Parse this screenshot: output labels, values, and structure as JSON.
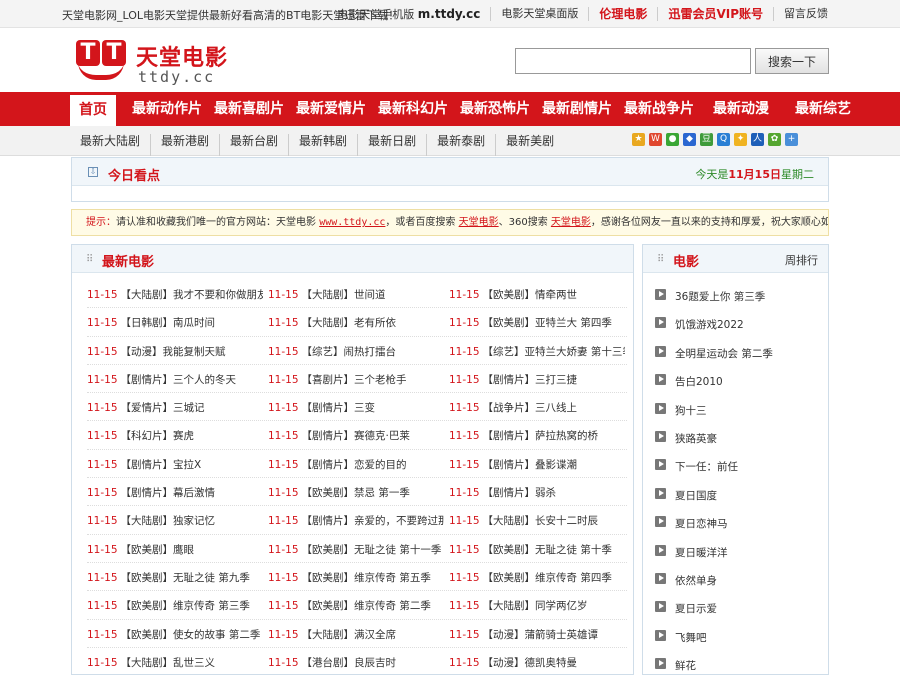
{
  "topbar": {
    "slogan": "天堂电影网_LOL电影天堂提供最新好看高清的BT电影天堂迅雷下载！",
    "mobile_label": "电影天堂手机版",
    "mobile_url": "m.ttdy.cc",
    "desktop_label": "电影天堂桌面版",
    "ethics_label": "伦理电影",
    "vip_label": "迅雷会员VIP账号",
    "feedback_label": "留言反馈"
  },
  "logo": {
    "cn": "天堂电影",
    "en": "ttdy.cc",
    "mark": "TT"
  },
  "search": {
    "value": "",
    "placeholder": "",
    "button": "搜索一下"
  },
  "nav": {
    "home": "首页",
    "items": [
      "最新动作片",
      "最新喜剧片",
      "最新爱情片",
      "最新科幻片",
      "最新恐怖片",
      "最新剧情片",
      "最新战争片",
      "最新动漫",
      "最新综艺"
    ]
  },
  "subnav": {
    "items": [
      "最新大陆剧",
      "最新港剧",
      "最新台剧",
      "最新韩剧",
      "最新日剧",
      "最新泰剧",
      "最新美剧"
    ],
    "share_icons": [
      "share-star-icon",
      "share-weibo-icon",
      "share-chat-icon",
      "share-baidu-icon",
      "share-douban-icon",
      "share-qq-icon",
      "share-qzone-icon",
      "share-renren-icon",
      "share-clover-icon",
      "share-plus-icon"
    ]
  },
  "today": {
    "title": "今日看点",
    "date_prefix": "今天是",
    "date": "11月15日",
    "weekday": "星期二"
  },
  "notice": {
    "label": "提示：",
    "text1": "请认准和收藏我们唯一的官方网站：天堂电影",
    "site": "www.ttdy.cc",
    "text2": "，或者百度搜索",
    "kw1": "天堂电影",
    "text3": "、360搜索",
    "kw2": "天堂电影",
    "text4": "，感谢各位网友一直以来的支持和厚爱，祝大家顺心如意！"
  },
  "latest": {
    "title": "最新电影",
    "rows": [
      [
        [
          "11-15",
          "【大陆剧】我才不要和你做朋友"
        ],
        [
          "11-15",
          "【大陆剧】世间道"
        ],
        [
          "11-15",
          "【欧美剧】情牵两世"
        ]
      ],
      [
        [
          "11-15",
          "【日韩剧】南瓜时间"
        ],
        [
          "11-15",
          "【大陆剧】老有所依"
        ],
        [
          "11-15",
          "【欧美剧】亚特兰大 第四季"
        ]
      ],
      [
        [
          "11-15",
          "【动漫】我能复制天赋"
        ],
        [
          "11-15",
          "【综艺】闹热打擂台"
        ],
        [
          "11-15",
          "【综艺】亚特兰大娇妻 第十三季"
        ]
      ],
      [
        [
          "11-15",
          "【剧情片】三个人的冬天"
        ],
        [
          "11-15",
          "【喜剧片】三个老枪手"
        ],
        [
          "11-15",
          "【剧情片】三打三捷"
        ]
      ],
      [
        [
          "11-15",
          "【爱情片】三城记"
        ],
        [
          "11-15",
          "【剧情片】三变"
        ],
        [
          "11-15",
          "【战争片】三八线上"
        ]
      ],
      [
        [
          "11-15",
          "【科幻片】赛虎"
        ],
        [
          "11-15",
          "【剧情片】赛德克·巴莱"
        ],
        [
          "11-15",
          "【剧情片】萨拉热窝的桥"
        ]
      ],
      [
        [
          "11-15",
          "【剧情片】宝拉X"
        ],
        [
          "11-15",
          "【剧情片】恋爱的目的"
        ],
        [
          "11-15",
          "【剧情片】叠影谍潮"
        ]
      ],
      [
        [
          "11-15",
          "【剧情片】幕后激情"
        ],
        [
          "11-15",
          "【欧美剧】禁忌 第一季"
        ],
        [
          "11-15",
          "【剧情片】弱杀"
        ]
      ],
      [
        [
          "11-15",
          "【大陆剧】独家记忆"
        ],
        [
          "11-15",
          "【剧情片】亲爱的，不要跨过那条江"
        ],
        [
          "11-15",
          "【大陆剧】长安十二时辰"
        ]
      ],
      [
        [
          "11-15",
          "【欧美剧】鹰眼"
        ],
        [
          "11-15",
          "【欧美剧】无耻之徒 第十一季"
        ],
        [
          "11-15",
          "【欧美剧】无耻之徒 第十季"
        ]
      ],
      [
        [
          "11-15",
          "【欧美剧】无耻之徒 第九季"
        ],
        [
          "11-15",
          "【欧美剧】维京传奇 第五季"
        ],
        [
          "11-15",
          "【欧美剧】维京传奇 第四季"
        ]
      ],
      [
        [
          "11-15",
          "【欧美剧】维京传奇 第三季"
        ],
        [
          "11-15",
          "【欧美剧】维京传奇 第二季"
        ],
        [
          "11-15",
          "【大陆剧】同学两亿岁"
        ]
      ],
      [
        [
          "11-15",
          "【欧美剧】使女的故事 第二季"
        ],
        [
          "11-15",
          "【大陆剧】满汉全席"
        ],
        [
          "11-15",
          "【动漫】蒲箭骑士英雄谭"
        ]
      ],
      [
        [
          "11-15",
          "【大陆剧】乱世三义"
        ],
        [
          "11-15",
          "【港台剧】良辰吉时"
        ],
        [
          "11-15",
          "【动漫】德凯奥特曼"
        ]
      ]
    ]
  },
  "movie_rank": {
    "title": "电影",
    "sort_label": "周排行",
    "items": [
      "36题爱上你 第三季",
      "饥饿游戏2022",
      "全明星运动会 第二季",
      "告白2010",
      "狗十三",
      "狭路英豪",
      "下一任：前任",
      "夏日国度",
      "夏日恋神马",
      "夏日暖洋洋",
      "依然单身",
      "夏日示爱",
      "飞舞吧",
      "鲜花"
    ]
  },
  "colors": {
    "brand_red": "#d3151b",
    "date_green": "#2d8a28",
    "panel_bg": "#f1f6fa"
  }
}
